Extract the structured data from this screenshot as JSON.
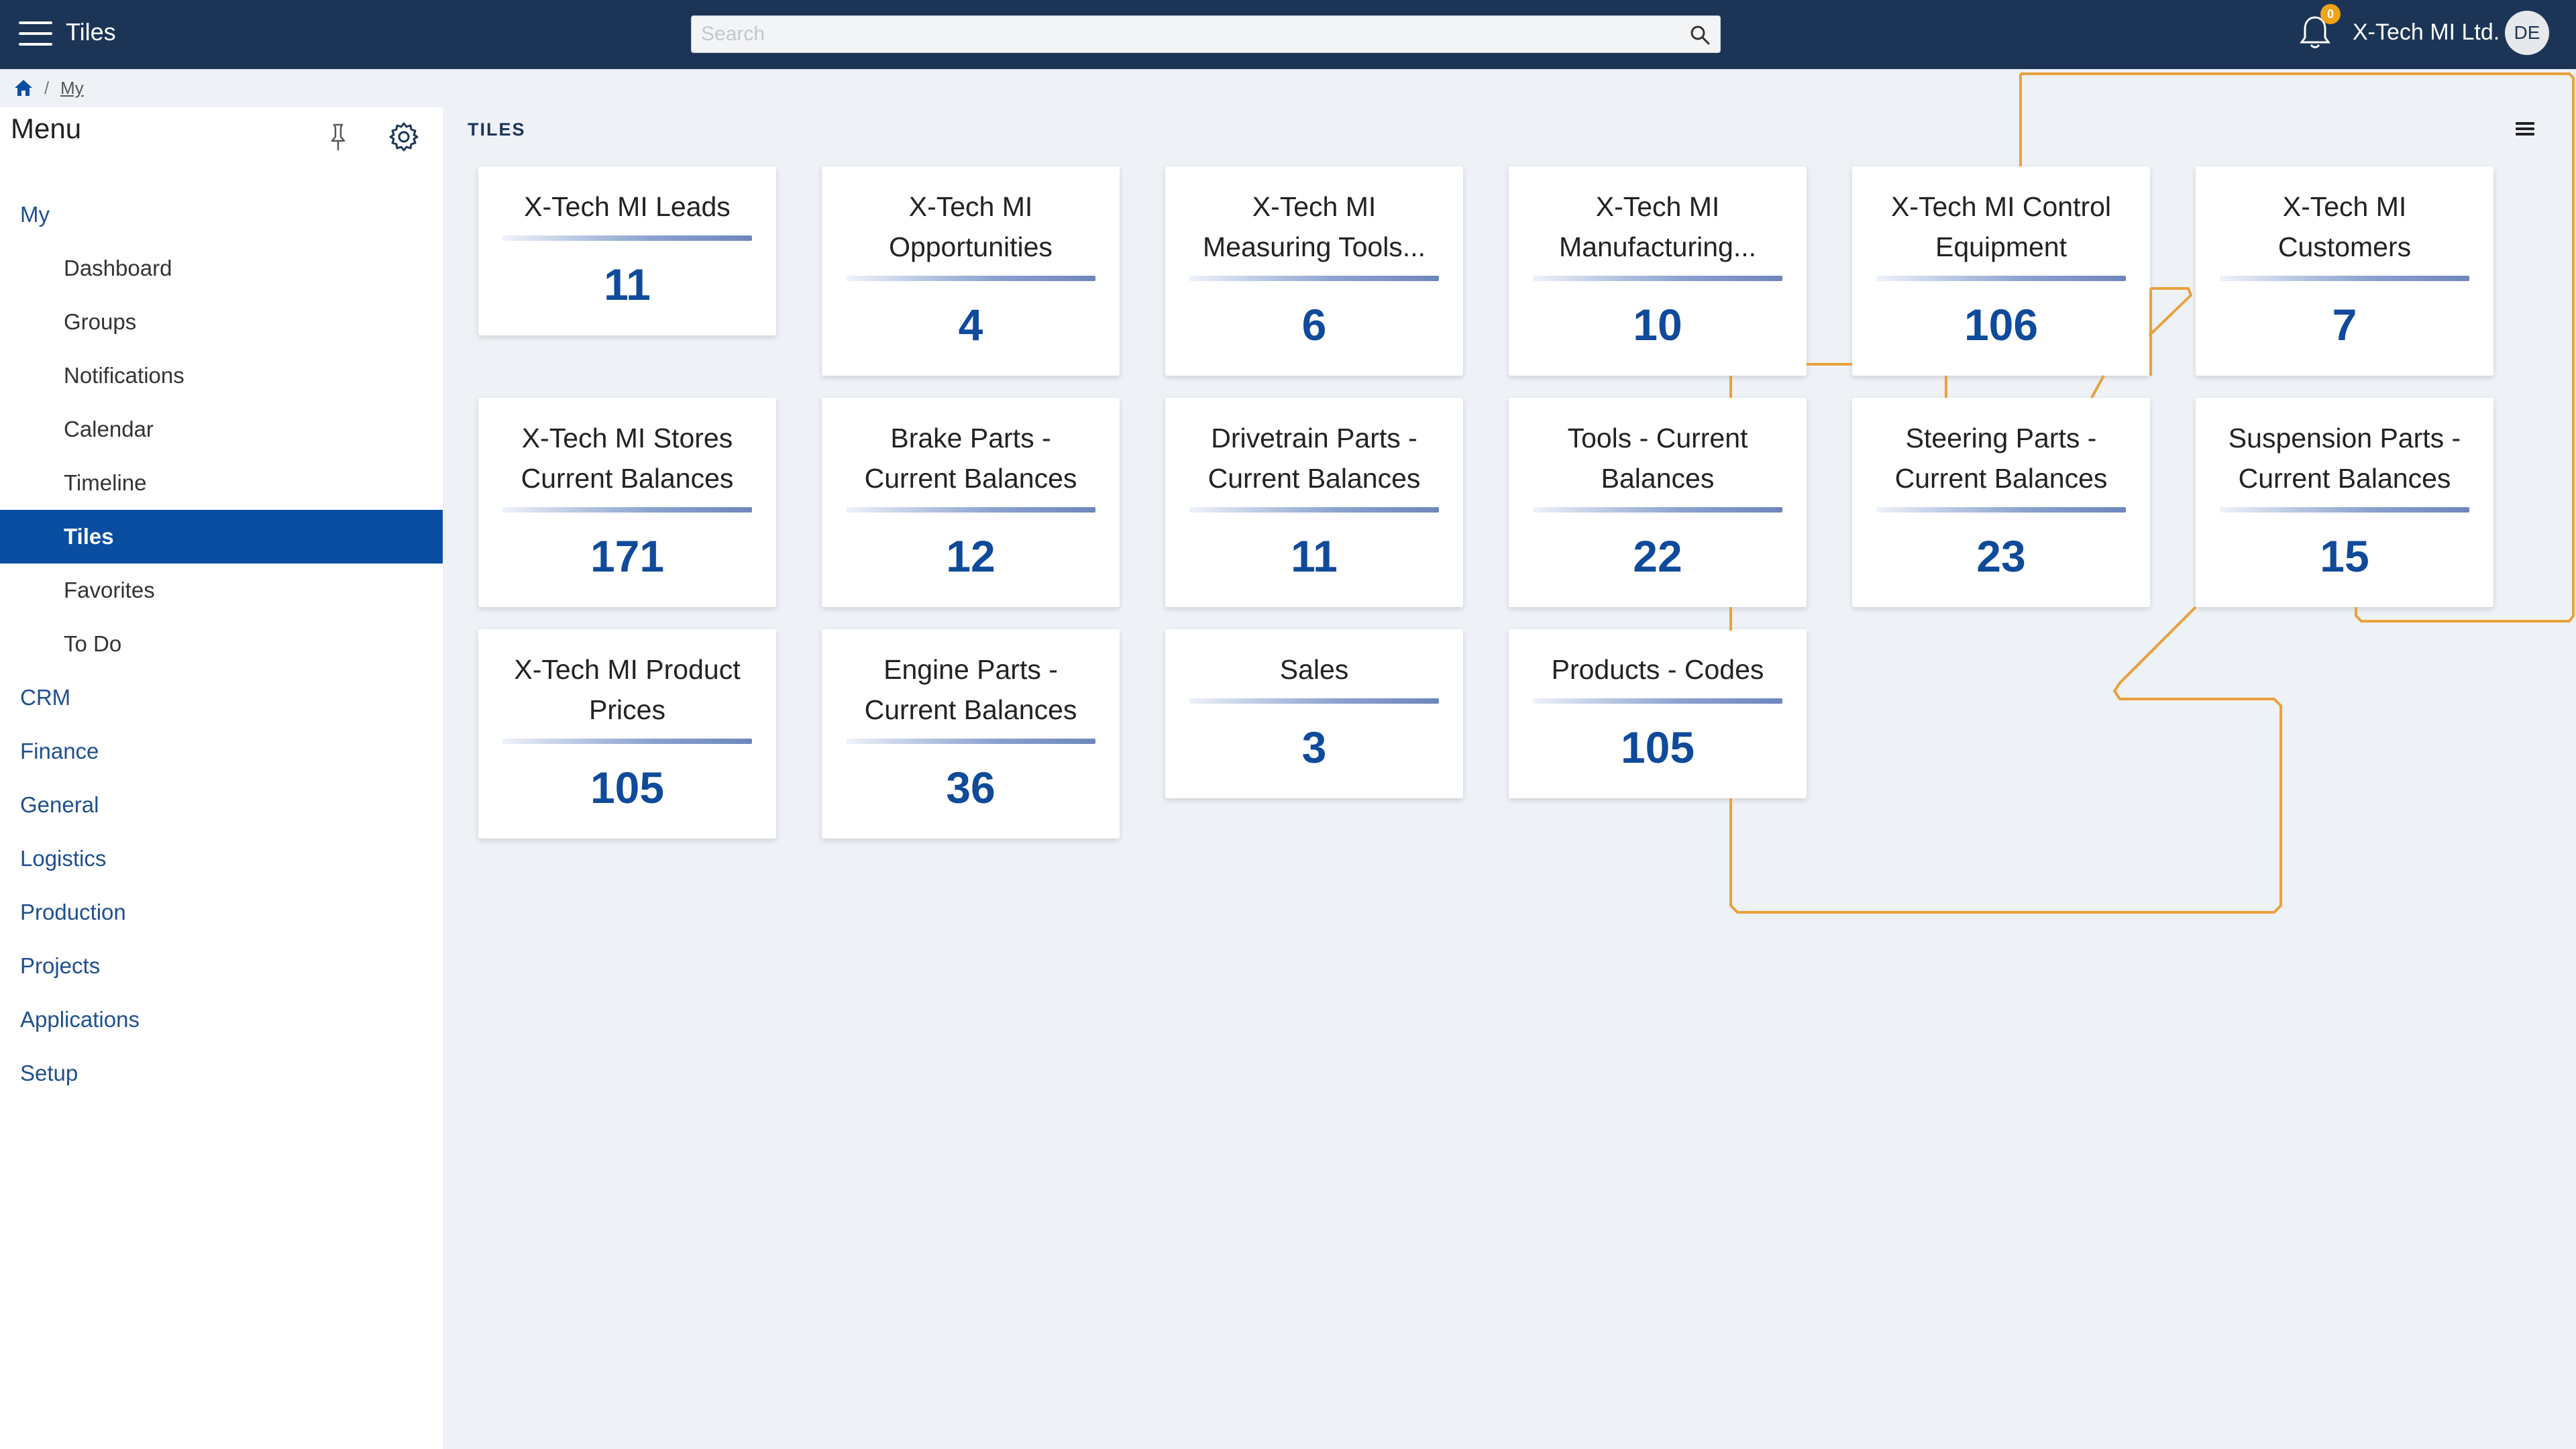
{
  "topbar": {
    "app_title": "Tiles",
    "search_placeholder": "Search",
    "search_value": "",
    "notification_count": "0",
    "company_name": "X-Tech MI Ltd.",
    "avatar_initials": "DE"
  },
  "breadcrumb": {
    "separator": "/",
    "current": "My"
  },
  "sidebar": {
    "title": "Menu",
    "sections": [
      {
        "label": "My",
        "items": [
          "Dashboard",
          "Groups",
          "Notifications",
          "Calendar",
          "Timeline",
          "Tiles",
          "Favorites",
          "To Do"
        ]
      },
      {
        "label": "CRM"
      },
      {
        "label": "Finance"
      },
      {
        "label": "General"
      },
      {
        "label": "Logistics"
      },
      {
        "label": "Production"
      },
      {
        "label": "Projects"
      },
      {
        "label": "Applications"
      },
      {
        "label": "Setup"
      }
    ],
    "active_item": "Tiles"
  },
  "main": {
    "header": "TILES",
    "tiles": [
      {
        "title_lines": [
          "X-Tech MI Leads"
        ],
        "value": "11"
      },
      {
        "title_lines": [
          "X-Tech MI",
          "Opportunities"
        ],
        "value": "4"
      },
      {
        "title_lines": [
          "X-Tech MI",
          "Measuring Tools..."
        ],
        "value": "6"
      },
      {
        "title_lines": [
          "X-Tech MI",
          "Manufacturing..."
        ],
        "value": "10"
      },
      {
        "title_lines": [
          "X-Tech MI Control",
          "Equipment"
        ],
        "value": "106"
      },
      {
        "title_lines": [
          "X-Tech MI",
          "Customers"
        ],
        "value": "7"
      },
      {
        "title_lines": [
          "X-Tech MI Stores",
          "Current Balances"
        ],
        "value": "171"
      },
      {
        "title_lines": [
          "Brake Parts -",
          "Current Balances"
        ],
        "value": "12"
      },
      {
        "title_lines": [
          "Drivetrain Parts -",
          "Current Balances"
        ],
        "value": "11"
      },
      {
        "title_lines": [
          "Tools - Current",
          "Balances"
        ],
        "value": "22"
      },
      {
        "title_lines": [
          "Steering Parts -",
          "Current Balances"
        ],
        "value": "23"
      },
      {
        "title_lines": [
          "Suspension Parts -",
          "Current Balances"
        ],
        "value": "15"
      },
      {
        "title_lines": [
          "X-Tech MI Product",
          "Prices"
        ],
        "value": "105"
      },
      {
        "title_lines": [
          "Engine Parts -",
          "Current Balances"
        ],
        "value": "36"
      },
      {
        "title_lines": [
          "Sales"
        ],
        "value": "3"
      },
      {
        "title_lines": [
          "Products - Codes"
        ],
        "value": "105"
      }
    ]
  },
  "colors": {
    "topbar_bg": "#1c3557",
    "accent_blue": "#0a4ea2",
    "value_blue": "#0f4a9b",
    "badge_orange": "#f0a318",
    "annotation_orange": "#e9a13b",
    "page_bg": "#eef1f6"
  },
  "icons": [
    "hamburger-icon",
    "search-icon",
    "bell-icon",
    "home-icon",
    "pin-icon",
    "gear-icon",
    "list-icon"
  ]
}
